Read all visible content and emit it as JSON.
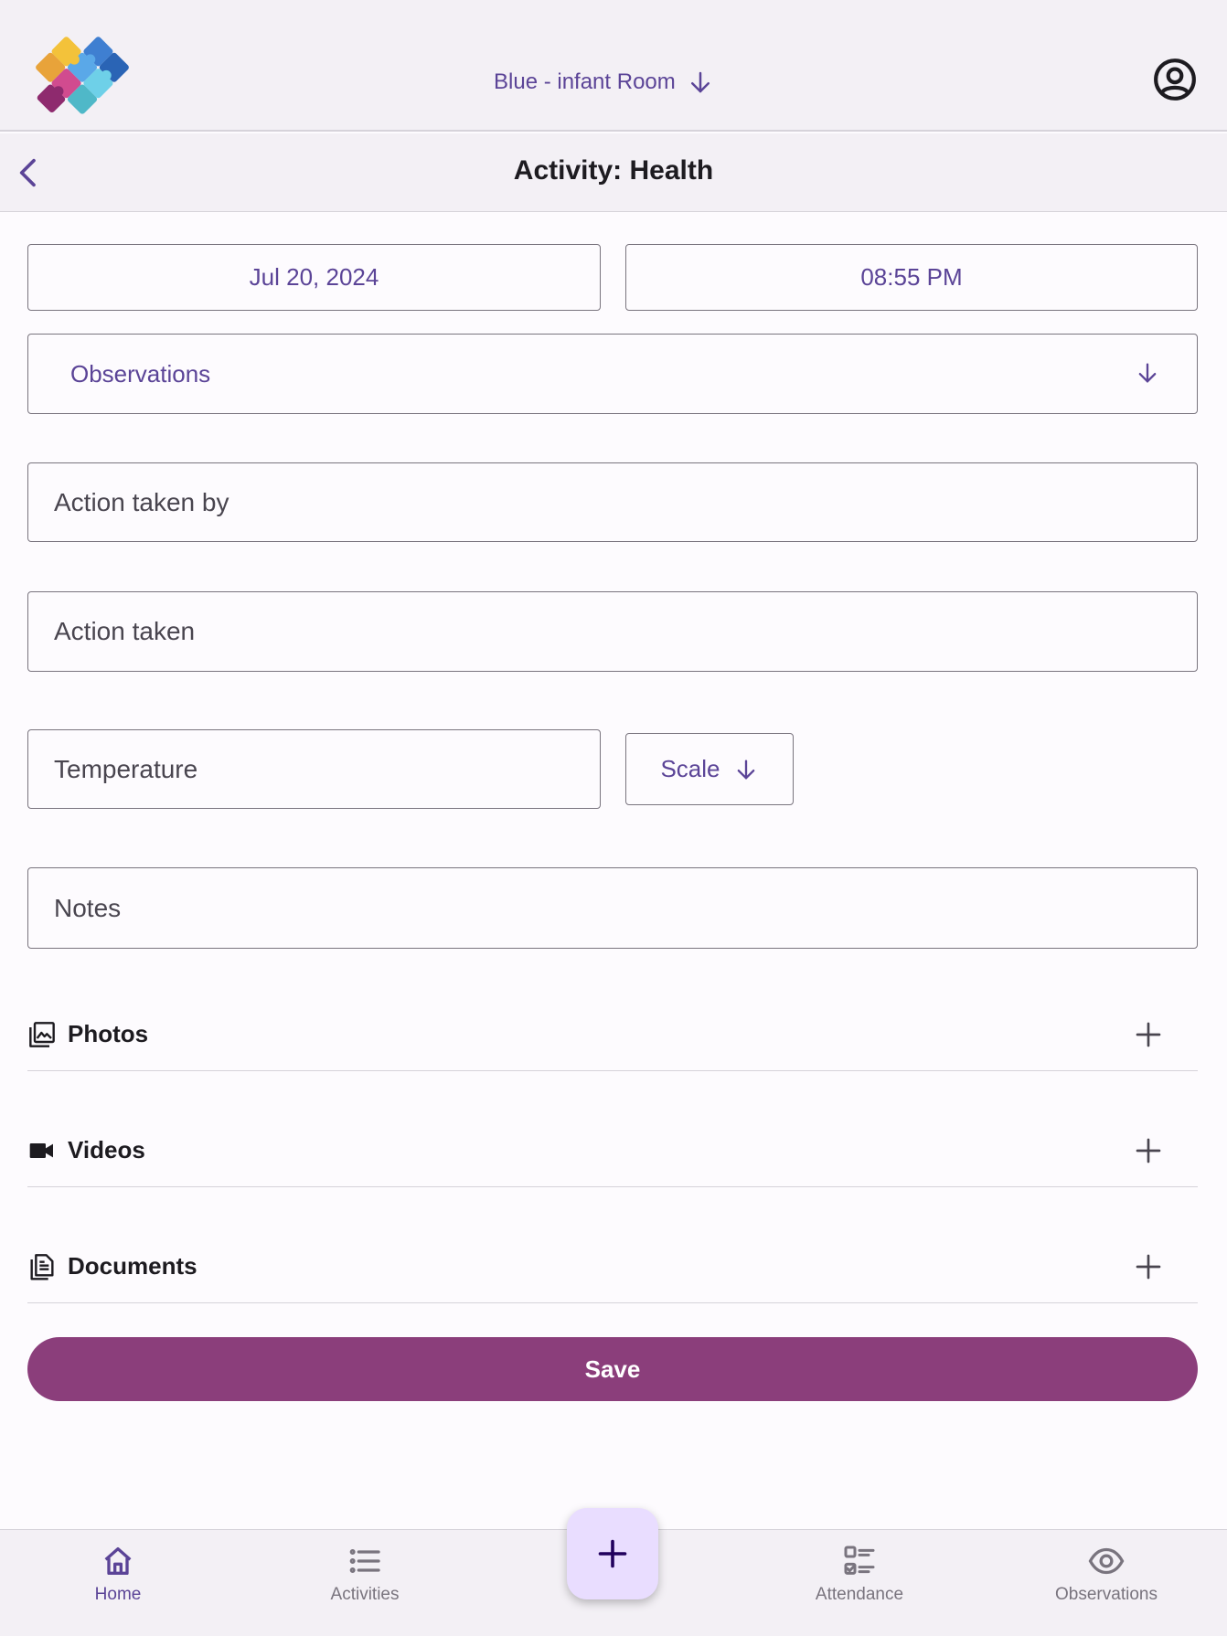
{
  "header": {
    "logo": "puzzle-logo",
    "room_label": "Blue - infant Room",
    "account_icon": "account-circle-icon"
  },
  "subheader": {
    "title": "Activity: Health",
    "back_icon": "chevron-left-icon"
  },
  "form": {
    "date": "Jul 20, 2024",
    "time": "08:55 PM",
    "category_select": "Observations",
    "action_taken_by_placeholder": "Action taken by",
    "action_taken_placeholder": "Action taken",
    "temperature_placeholder": "Temperature",
    "scale_label": "Scale",
    "notes_placeholder": "Notes"
  },
  "attachments": [
    {
      "label": "Photos",
      "icon": "photo-library-icon"
    },
    {
      "label": "Videos",
      "icon": "videocam-icon"
    },
    {
      "label": "Documents",
      "icon": "document-icon"
    }
  ],
  "save_label": "Save",
  "bottom_nav": {
    "items": [
      {
        "label": "Home",
        "icon": "home-icon",
        "active": true
      },
      {
        "label": "Activities",
        "icon": "list-icon",
        "active": false
      },
      {
        "label": "Attendance",
        "icon": "checklist-icon",
        "active": false
      },
      {
        "label": "Observations",
        "icon": "eye-icon",
        "active": false
      }
    ],
    "fab_icon": "plus-icon"
  },
  "colors": {
    "primary": "#5b4497",
    "save_button": "#8b3e7b",
    "fab_background": "#e9ddff",
    "bar_background": "#f3f0f5"
  }
}
